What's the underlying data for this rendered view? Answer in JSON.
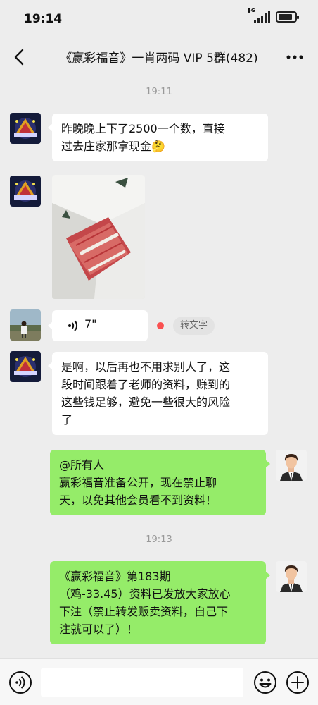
{
  "status_bar": {
    "time": "19:14",
    "network": "5G",
    "battery_level": 0.85
  },
  "header": {
    "title": "《赢彩福音》一肖两码 VIP 5群(482)"
  },
  "timestamps": [
    "19:11",
    "19:13"
  ],
  "messages": {
    "m1": {
      "lines": [
        "昨晚晚上下了2500一个数，直接",
        "过去庄家那拿现金🤔"
      ]
    },
    "m3": {
      "duration": "7\"",
      "convert_label": "转文字"
    },
    "m4": {
      "lines": [
        "是啊，以后再也不用求别人了，这",
        "段时间跟着了老师的资料，赚到的",
        "这些钱足够，避免一些很大的风险",
        "了"
      ]
    },
    "m5": {
      "lines": [
        "@所有人",
        "赢彩福音准备公开，现在禁止聊",
        "天，以免其他会员看不到资料！"
      ]
    },
    "m6": {
      "lines": [
        "《赢彩福音》第183期",
        "（鸡-33.45）资料已发放大家放心",
        "下注（禁止转发贩卖资料，自己下",
        "注就可以了）！"
      ]
    }
  },
  "icons": {
    "back": "chevron-left-icon",
    "more": "more-dots-icon",
    "voice_input": "voice-input-icon",
    "emoji": "emoji-icon",
    "plus": "plus-icon"
  },
  "colors": {
    "background": "#ededed",
    "bubble_self": "#95ec69",
    "bubble_other": "#ffffff",
    "unread": "#fa5151"
  }
}
